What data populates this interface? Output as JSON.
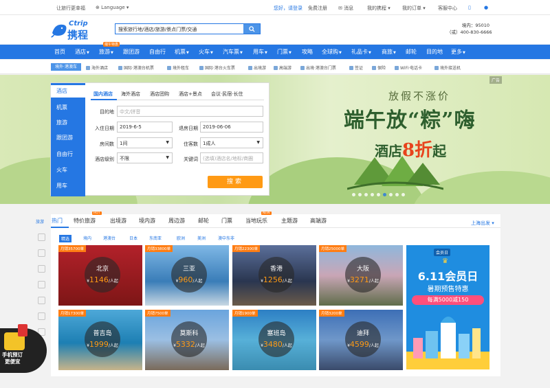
{
  "topbar": {
    "slogan": "让旅行更幸福",
    "language": "Language",
    "hello": "您好，请登录",
    "register": "免费注册",
    "messages": "消息",
    "my_trips": "我的携程",
    "my_orders": "我的订单",
    "service": "客服中心"
  },
  "header": {
    "logo_en": "Ctrip",
    "logo_cn": "携程",
    "search_value": "搜索旅行地/酒店/旅游/景点门票/交通",
    "hotline_domestic": "境内：95010",
    "hotline_intl": "（或）400-830-6666"
  },
  "nav": {
    "items": [
      "首页",
      "酒店",
      "旅游",
      "跟团游",
      "自由行",
      "机票",
      "火车",
      "汽车票",
      "用车",
      "门票",
      "攻略",
      "全球购",
      "礼品卡",
      "商旅",
      "邮轮",
      "目的地",
      "更多"
    ],
    "hot_badge": "端午特惠"
  },
  "subnav": {
    "label": "境外·港澳车",
    "items": [
      "海外酒店",
      "国际·港澳台机票",
      "境外租车",
      "国际·港台火车票",
      "出境游",
      "高端游",
      "出境·港澳台门票",
      "签证",
      "保险",
      "WiFi·电话卡",
      "境外接送机"
    ]
  },
  "banner": {
    "slogan1": "放假不涨价",
    "slogan2": "端午放“粽”嗨",
    "slogan3_pre": "酒店",
    "slogan3_num": "8折",
    "slogan3_post": "起",
    "ad": "广告"
  },
  "booking": {
    "side": [
      "酒店",
      "机票",
      "旅游",
      "跟团游",
      "自由行",
      "火车",
      "用车"
    ],
    "tabs": [
      "国内酒店",
      "海外酒店",
      "酒店团购",
      "酒店+景点",
      "会议·民宿·长住"
    ],
    "dest_label": "目的地",
    "dest_ph": "中文/拼音",
    "checkin_label": "入住日期",
    "checkin": "2019-6-5",
    "checkout_label": "退房日期",
    "checkout": "2019-06-06",
    "rooms_label": "房间数",
    "rooms": "1间",
    "guests_label": "住客数",
    "guests": "1成人",
    "level_label": "酒店级别",
    "level": "不限",
    "kw_label": "关键词",
    "kw_ph": "(选填)酒店名/地标/商圈",
    "search": "搜索"
  },
  "panel": {
    "tabs": [
      "热门",
      "特价旅游",
      "出境游",
      "境内游",
      "周边游",
      "邮轮",
      "门票",
      "当地玩乐",
      "主题游",
      "高端游"
    ],
    "badge_hot": "HOT",
    "badge_new": "NEW",
    "city": "上海出发",
    "rail_label": "旅游",
    "chips": [
      "精选",
      "境内",
      "港澳台",
      "日本",
      "东南亚",
      "欧洲",
      "美洲",
      "澳中东非"
    ],
    "cards": [
      {
        "tag": "月销35700单",
        "name": "北京",
        "price": "1146",
        "unit": "/人起"
      },
      {
        "tag": "月销33800单",
        "name": "三亚",
        "price": "960",
        "unit": "/人起"
      },
      {
        "tag": "月销22300单",
        "name": "香港",
        "price": "1256",
        "unit": "/人起"
      },
      {
        "tag": "月销25000单",
        "name": "大阪",
        "price": "3271",
        "unit": "/人起"
      },
      {
        "tag": "月销17300单",
        "name": "普吉岛",
        "price": "1999",
        "unit": "/人起"
      },
      {
        "tag": "月销7500单",
        "name": "莫斯科",
        "price": "5332",
        "unit": "/人起"
      },
      {
        "tag": "月销1900单",
        "name": "塞班岛",
        "price": "3480",
        "unit": "/人起"
      },
      {
        "tag": "月销3200单",
        "name": "迪拜",
        "price": "4599",
        "unit": "/人起"
      }
    ],
    "promo": {
      "brand": "会员日",
      "title": "6.11会员日",
      "sub": "暑期预售特惠",
      "deal": "每满5000减150"
    }
  },
  "floater": {
    "line1": "手机预订",
    "line2": "更便宜"
  }
}
